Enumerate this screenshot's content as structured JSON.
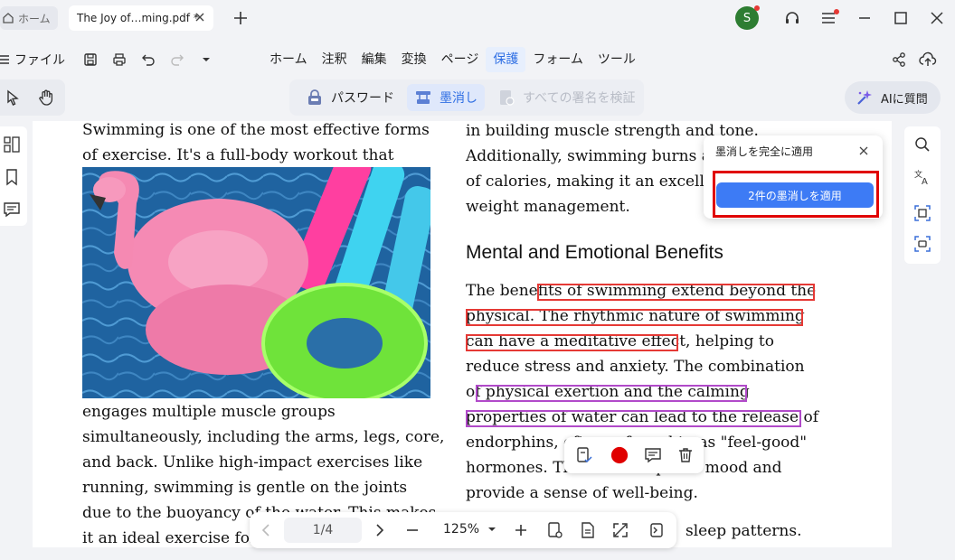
{
  "tabs": {
    "home_label": "ホーム",
    "doc_label": "The Joy of…ming.pdf *"
  },
  "user": {
    "avatar_letter": "S"
  },
  "menu": {
    "file_label": "ファイル",
    "items": [
      "ホーム",
      "注釈",
      "編集",
      "変換",
      "ページ",
      "保護",
      "フォーム",
      "ツール"
    ],
    "active": "保護"
  },
  "protect_toolbar": {
    "password_label": "パスワード",
    "redact_label": "墨消し",
    "verify_label": "すべての署名を検証"
  },
  "ai": {
    "label": "AIに質問"
  },
  "document": {
    "left_lines": [
      "Swimming is one of the most effective forms",
      "of exercise. It's a full-body workout that"
    ],
    "left_lines_after_image": [
      "engages multiple muscle groups",
      "simultaneously, including the arms, legs, core,",
      "and back. Unlike high-impact exercises like",
      "running, swimming is gentle on the joints",
      "due to the buoyancy of the water. This makes",
      "it an ideal exercise for"
    ],
    "right_lines_top": [
      "in building muscle strength and tone.",
      "Additionally, swimming burns a",
      "of calories, making it an excelle",
      "weight management."
    ],
    "heading": "Mental and Emotional Benefits",
    "right_lines_bottom": [
      "The benefits of swimming extend beyond the",
      "physical. The rhythmic nature of swimming",
      "can have a meditative effect, helping to",
      "reduce stress and anxiety. The combination",
      "of physical exertion and the calming",
      "properties of water can lead to the release of",
      "endorphins, often referred to as \"feel-good\"",
      "hormones. These can improve mood and",
      "provide a sense of well-being.",
      "sleep patterns."
    ]
  },
  "popup": {
    "title": "墨消しを完全に適用",
    "apply_label": "2件の墨消しを適用"
  },
  "pagination": {
    "page_display": "1/4",
    "zoom_display": "125%"
  },
  "colors": {
    "accent": "#2f6fe4",
    "apply_button": "#3d7bf5",
    "redaction_red": "#e53935",
    "redaction_purple": "#b14ac9",
    "highlight_box": "#e00000"
  }
}
